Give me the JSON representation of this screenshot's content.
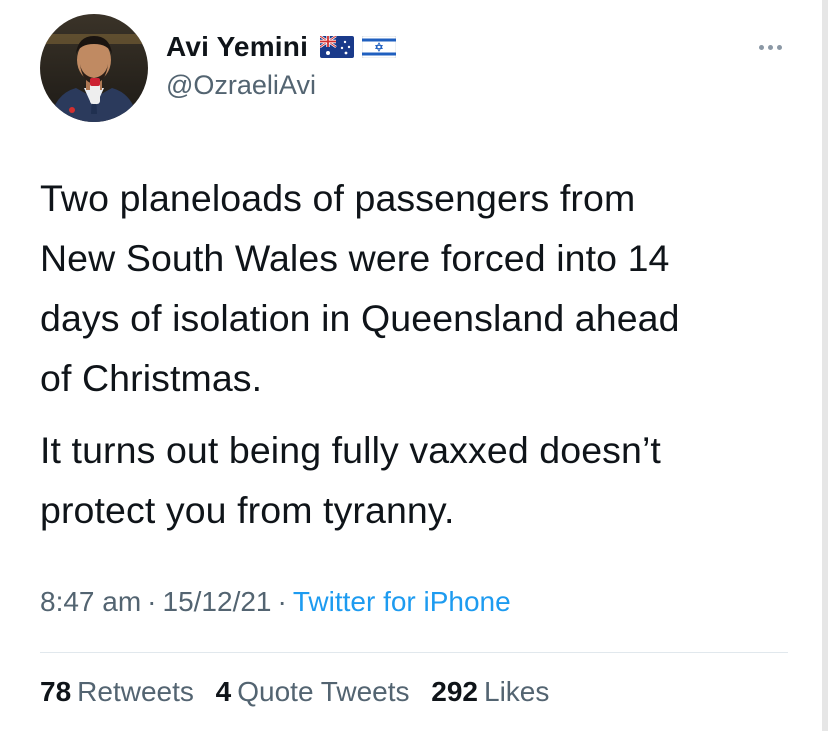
{
  "author": {
    "display_name": "Avi Yemini",
    "handle": "@OzraeliAvi",
    "flags": [
      "australia-flag-icon",
      "israel-flag-icon"
    ]
  },
  "tweet": {
    "paragraphs": [
      "Two planeloads of passengers from\nNew South Wales were forced into 14\ndays of isolation in Queensland ahead\nof Christmas.",
      "It turns out being fully vaxxed doesn’t\nprotect you from tyranny."
    ],
    "time": "8:47 am",
    "date": "15/12/21",
    "separator": "·",
    "source": "Twitter for iPhone"
  },
  "stats": {
    "retweets_count": "78",
    "retweets_label": "Retweets",
    "quote_count": "4",
    "quote_label": "Quote Tweets",
    "likes_count": "292",
    "likes_label": "Likes"
  },
  "colors": {
    "text_primary": "#0f1419",
    "text_secondary": "#536471",
    "link_blue": "#1d9bf0",
    "divider": "#e1e8ed"
  },
  "icons": {
    "more": "more-options-icon"
  }
}
